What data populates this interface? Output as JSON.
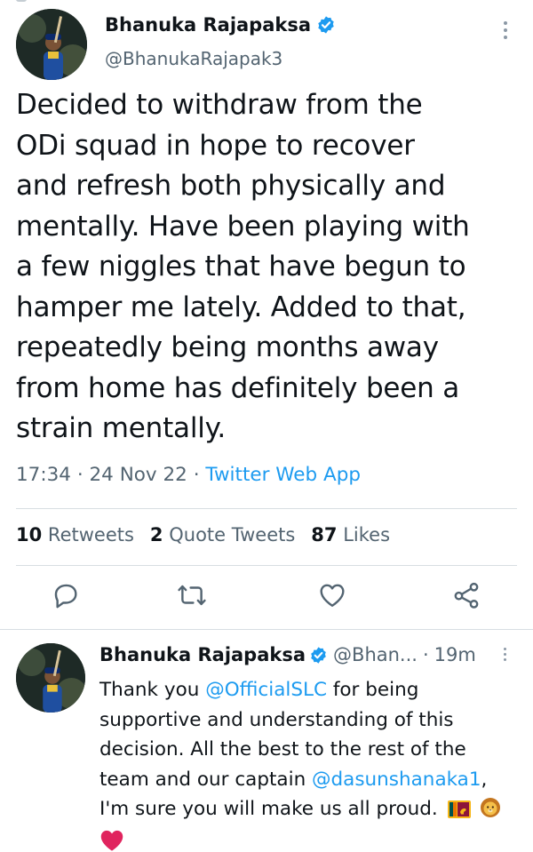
{
  "main_tweet": {
    "display_name": "Bhanuka Rajapaksa",
    "handle": "@BhanukaRajapak3",
    "text_lines": [
      "Decided to withdraw from the",
      "ODi squad in hope to recover",
      "and refresh both physically and",
      "mentally. Have been playing with",
      "a few niggles that have begun to",
      "hamper me lately. Added to that,",
      "repeatedly being months away",
      "from home has definitely been a",
      "strain mentally."
    ],
    "time": "17:34",
    "date": "24 Nov 22",
    "separator": "·",
    "source_app": "Twitter Web App",
    "stats": {
      "retweets_count": "10",
      "retweets_label": "Retweets",
      "quotes_count": "2",
      "quotes_label": "Quote Tweets",
      "likes_count": "87",
      "likes_label": "Likes"
    }
  },
  "actions": [
    "reply",
    "retweet",
    "like",
    "share"
  ],
  "reply_tweet": {
    "display_name": "Bhanuka Rajapaksa",
    "handle_truncated": "@Bhan...",
    "separator": "·",
    "age": "19m",
    "line1_text": "Thank you ",
    "line1_mention": "@OfficialSLC",
    "line1_rest": " for being",
    "line2": "supportive and understanding of this",
    "line3": "decision. All the best to the rest of the",
    "line4_text": "team and our captain ",
    "line4_mention": "@dasunshanaka1",
    "line4_rest": ",",
    "line5": "I'm sure you will make us all proud."
  },
  "colors": {
    "link": "#1d9bf0",
    "muted": "#536471",
    "text": "#0f1419",
    "verified": "#1d9bf0",
    "heart": "#e0245e"
  }
}
